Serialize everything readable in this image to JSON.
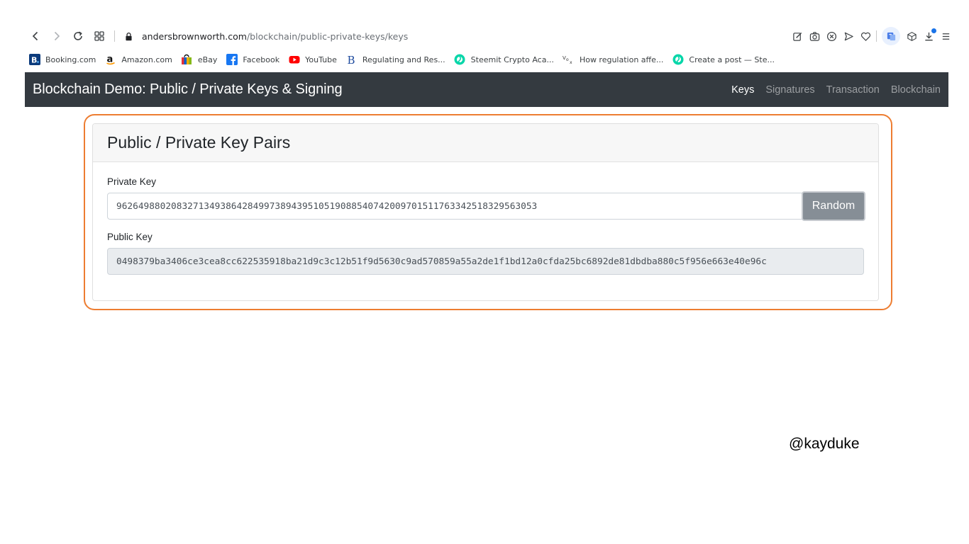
{
  "browser": {
    "url_host": "andersbrownworth.com",
    "url_path": "/blockchain/public-private-keys/keys",
    "nav_icons": [
      "back-icon",
      "forward-icon",
      "reload-icon",
      "apps-icon"
    ],
    "toolbar_icons": [
      "edit-icon",
      "camera-icon",
      "close-circle-icon",
      "send-icon",
      "heart-icon",
      "translate-icon",
      "cube-icon",
      "download-icon",
      "menu-icon"
    ],
    "bookmarks": [
      {
        "label": "Booking.com",
        "icon": "booking-icon"
      },
      {
        "label": "Amazon.com",
        "icon": "amazon-icon"
      },
      {
        "label": "eBay",
        "icon": "ebay-icon"
      },
      {
        "label": "Facebook",
        "icon": "facebook-icon"
      },
      {
        "label": "YouTube",
        "icon": "youtube-icon"
      },
      {
        "label": "Regulating and Res...",
        "icon": "b-logo-icon"
      },
      {
        "label": "Steemit Crypto Aca...",
        "icon": "steemit-icon"
      },
      {
        "label": "How regulation affe...",
        "icon": "vox-icon"
      },
      {
        "label": "Create a post — Ste...",
        "icon": "steemit-icon"
      }
    ]
  },
  "site": {
    "brand": "Blockchain Demo: Public / Private Keys & Signing",
    "nav": [
      {
        "label": "Keys",
        "active": true
      },
      {
        "label": "Signatures",
        "active": false
      },
      {
        "label": "Transaction",
        "active": false
      },
      {
        "label": "Blockchain",
        "active": false
      }
    ]
  },
  "card": {
    "title": "Public / Private Key Pairs",
    "private_label": "Private Key",
    "private_value": "96264988020832713493864284997389439510519088540742009701511763342518329563053",
    "random_label": "Random",
    "public_label": "Public Key",
    "public_value": "0498379ba3406ce3cea8cc622535918ba21d9c3c12b51f9d5630c9ad570859a55a2de1f1bd12a0cfda25bc6892de81dbdba880c5f956e663e40e96c"
  },
  "watermark": "@kayduke",
  "colors": {
    "navbar_bg": "#343a40",
    "highlight_border": "#ed7d31",
    "button_bg": "#868e96",
    "readonly_bg": "#e9ecef"
  }
}
